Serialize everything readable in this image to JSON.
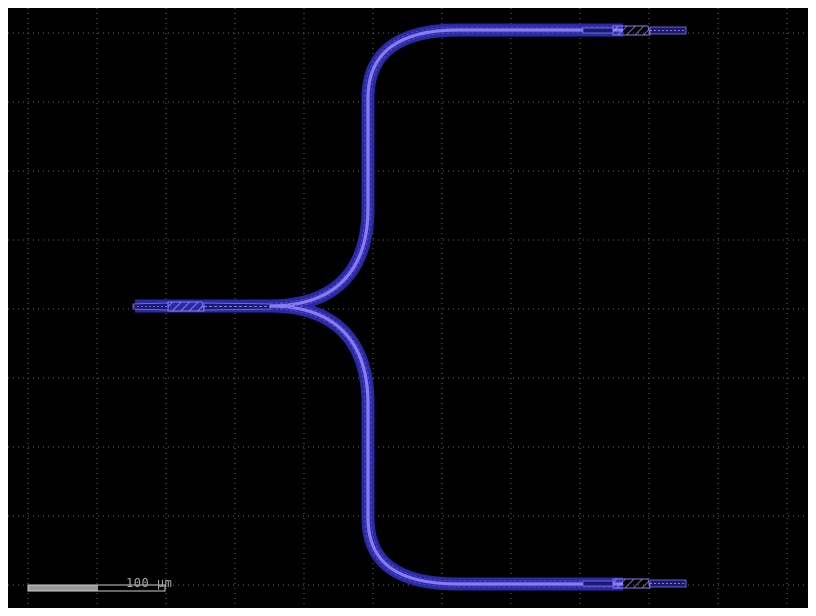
{
  "scale_bar": {
    "label": "100 µm"
  },
  "colors": {
    "background": "#000000",
    "grid": "#6a6a6a",
    "waveguide_core": "#8a7cf0",
    "waveguide_cladding": "#2a2aa6",
    "hatch": "#a89cff",
    "scalebar_fill": "#9a9a9a",
    "scalebar_outline": "#cfcfcf"
  },
  "component": {
    "type": "y-branch splitter",
    "ports": [
      "input-port",
      "output-port-top",
      "output-port-bottom"
    ]
  }
}
